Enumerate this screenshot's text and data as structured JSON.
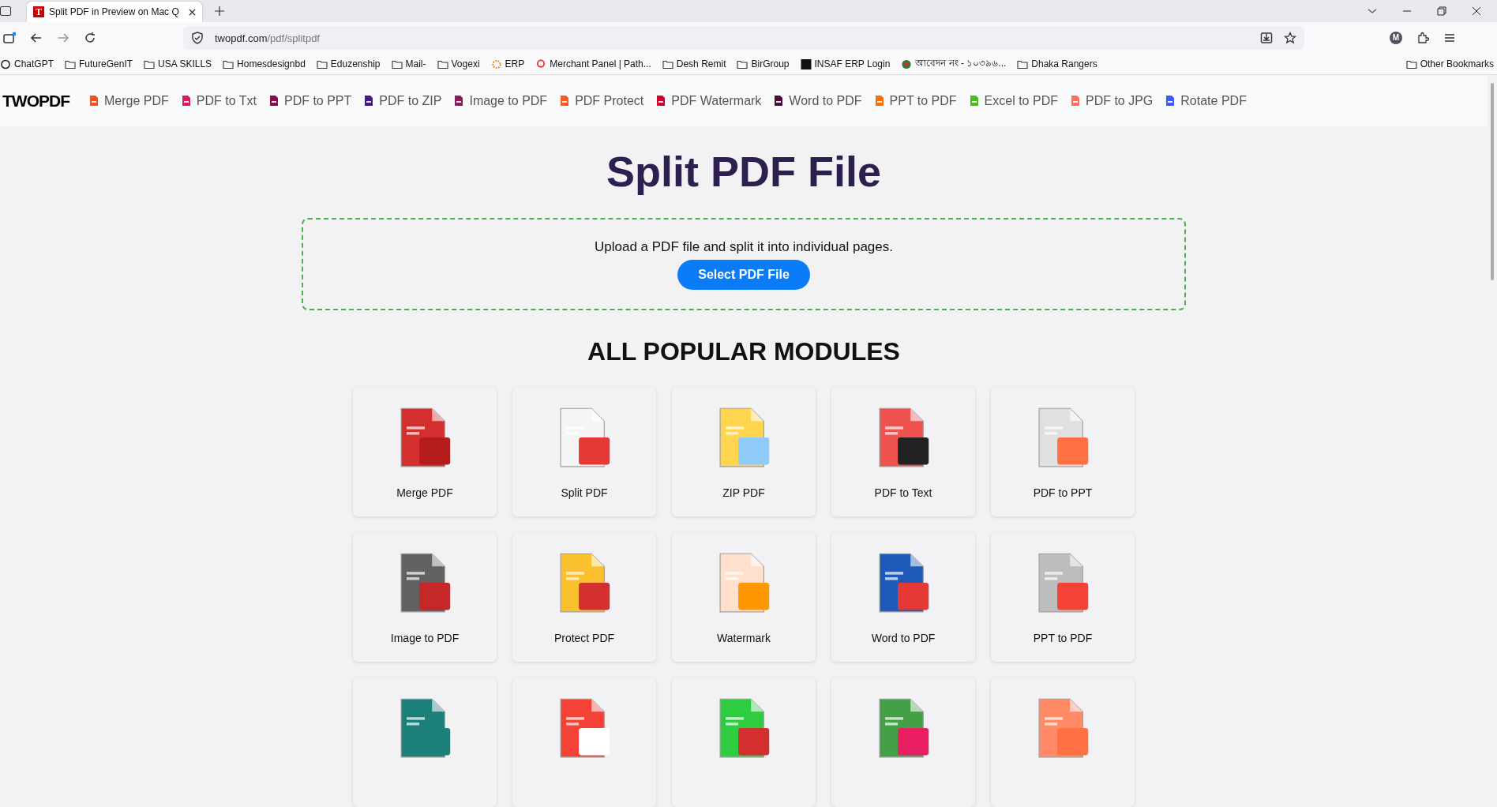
{
  "browser": {
    "tab": {
      "favicon_letter": "T",
      "title": "Split PDF in Preview on Mac Q",
      "selected": true
    },
    "address": {
      "domain": "twopdf.com",
      "path": "/pdf/splitpdf"
    },
    "profile_letter": "M",
    "bookmarks": [
      {
        "kind": "site",
        "label": "ChatGPT"
      },
      {
        "kind": "folder",
        "label": "FutureGenIT"
      },
      {
        "kind": "folder",
        "label": "USA SKILLS"
      },
      {
        "kind": "folder",
        "label": "Homesdesignbd"
      },
      {
        "kind": "folder",
        "label": "Eduzenship"
      },
      {
        "kind": "folder",
        "label": "Mail-"
      },
      {
        "kind": "folder",
        "label": "Vogexi"
      },
      {
        "kind": "site",
        "label": "ERP"
      },
      {
        "kind": "site",
        "label": "Merchant Panel | Path..."
      },
      {
        "kind": "folder",
        "label": "Desh Remit"
      },
      {
        "kind": "folder",
        "label": "BirGroup"
      },
      {
        "kind": "site",
        "label": "INSAF ERP Login"
      },
      {
        "kind": "site",
        "label": "আবেদন নং - ১০৩৯৬..."
      },
      {
        "kind": "folder",
        "label": "Dhaka Rangers"
      }
    ],
    "other_bookmarks": "Other Bookmarks"
  },
  "site": {
    "logo": "TWOPDF",
    "nav": [
      {
        "label": "Merge PDF",
        "color": "#f4511e"
      },
      {
        "label": "PDF to Txt",
        "color": "#d81b60"
      },
      {
        "label": "PDF to PPT",
        "color": "#880e4f"
      },
      {
        "label": "PDF to ZIP",
        "color": "#4a148c"
      },
      {
        "label": "Image to PDF",
        "color": "#8e1b5a"
      },
      {
        "label": "PDF Protect",
        "color": "#ff5722"
      },
      {
        "label": "PDF Watermark",
        "color": "#d50032"
      },
      {
        "label": "Word to PDF",
        "color": "#4a0d3a"
      },
      {
        "label": "PPT to PDF",
        "color": "#ff6d00"
      },
      {
        "label": "Excel to PDF",
        "color": "#43c01a"
      },
      {
        "label": "PDF to JPG",
        "color": "#ff6f61"
      },
      {
        "label": "Rotate PDF",
        "color": "#3d5afe"
      }
    ]
  },
  "page": {
    "title": "Split PDF File",
    "upload": {
      "text": "Upload a PDF file and split it into individual pages.",
      "button": "Select PDF File"
    },
    "modules_heading": "ALL POPULAR MODULES",
    "modules": [
      {
        "kind": "labeled",
        "label": "Merge PDF"
      },
      {
        "kind": "labeled",
        "label": "Split PDF"
      },
      {
        "kind": "labeled",
        "label": "ZIP PDF"
      },
      {
        "kind": "labeled",
        "label": "PDF to Text"
      },
      {
        "kind": "labeled",
        "label": "PDF to PPT"
      },
      {
        "kind": "labeled",
        "label": "Image to PDF"
      },
      {
        "kind": "labeled",
        "label": "Protect PDF"
      },
      {
        "kind": "labeled",
        "label": "Watermark"
      },
      {
        "kind": "labeled",
        "label": "Word to PDF"
      },
      {
        "kind": "labeled",
        "label": "PPT to PDF"
      },
      {
        "kind": "icon_only"
      },
      {
        "kind": "icon_only"
      },
      {
        "kind": "icon_only"
      },
      {
        "kind": "icon_only"
      },
      {
        "kind": "icon_only"
      }
    ]
  }
}
